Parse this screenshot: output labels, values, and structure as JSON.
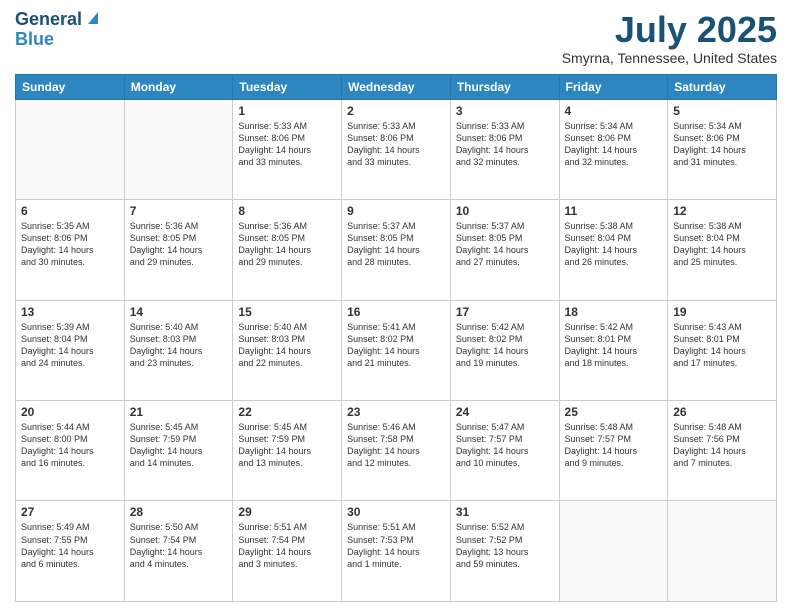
{
  "header": {
    "logo_line1": "General",
    "logo_line2": "Blue",
    "month": "July 2025",
    "location": "Smyrna, Tennessee, United States"
  },
  "weekdays": [
    "Sunday",
    "Monday",
    "Tuesday",
    "Wednesday",
    "Thursday",
    "Friday",
    "Saturday"
  ],
  "weeks": [
    [
      {
        "day": "",
        "lines": []
      },
      {
        "day": "",
        "lines": []
      },
      {
        "day": "1",
        "lines": [
          "Sunrise: 5:33 AM",
          "Sunset: 8:06 PM",
          "Daylight: 14 hours",
          "and 33 minutes."
        ]
      },
      {
        "day": "2",
        "lines": [
          "Sunrise: 5:33 AM",
          "Sunset: 8:06 PM",
          "Daylight: 14 hours",
          "and 33 minutes."
        ]
      },
      {
        "day": "3",
        "lines": [
          "Sunrise: 5:33 AM",
          "Sunset: 8:06 PM",
          "Daylight: 14 hours",
          "and 32 minutes."
        ]
      },
      {
        "day": "4",
        "lines": [
          "Sunrise: 5:34 AM",
          "Sunset: 8:06 PM",
          "Daylight: 14 hours",
          "and 32 minutes."
        ]
      },
      {
        "day": "5",
        "lines": [
          "Sunrise: 5:34 AM",
          "Sunset: 8:06 PM",
          "Daylight: 14 hours",
          "and 31 minutes."
        ]
      }
    ],
    [
      {
        "day": "6",
        "lines": [
          "Sunrise: 5:35 AM",
          "Sunset: 8:06 PM",
          "Daylight: 14 hours",
          "and 30 minutes."
        ]
      },
      {
        "day": "7",
        "lines": [
          "Sunrise: 5:36 AM",
          "Sunset: 8:05 PM",
          "Daylight: 14 hours",
          "and 29 minutes."
        ]
      },
      {
        "day": "8",
        "lines": [
          "Sunrise: 5:36 AM",
          "Sunset: 8:05 PM",
          "Daylight: 14 hours",
          "and 29 minutes."
        ]
      },
      {
        "day": "9",
        "lines": [
          "Sunrise: 5:37 AM",
          "Sunset: 8:05 PM",
          "Daylight: 14 hours",
          "and 28 minutes."
        ]
      },
      {
        "day": "10",
        "lines": [
          "Sunrise: 5:37 AM",
          "Sunset: 8:05 PM",
          "Daylight: 14 hours",
          "and 27 minutes."
        ]
      },
      {
        "day": "11",
        "lines": [
          "Sunrise: 5:38 AM",
          "Sunset: 8:04 PM",
          "Daylight: 14 hours",
          "and 26 minutes."
        ]
      },
      {
        "day": "12",
        "lines": [
          "Sunrise: 5:38 AM",
          "Sunset: 8:04 PM",
          "Daylight: 14 hours",
          "and 25 minutes."
        ]
      }
    ],
    [
      {
        "day": "13",
        "lines": [
          "Sunrise: 5:39 AM",
          "Sunset: 8:04 PM",
          "Daylight: 14 hours",
          "and 24 minutes."
        ]
      },
      {
        "day": "14",
        "lines": [
          "Sunrise: 5:40 AM",
          "Sunset: 8:03 PM",
          "Daylight: 14 hours",
          "and 23 minutes."
        ]
      },
      {
        "day": "15",
        "lines": [
          "Sunrise: 5:40 AM",
          "Sunset: 8:03 PM",
          "Daylight: 14 hours",
          "and 22 minutes."
        ]
      },
      {
        "day": "16",
        "lines": [
          "Sunrise: 5:41 AM",
          "Sunset: 8:02 PM",
          "Daylight: 14 hours",
          "and 21 minutes."
        ]
      },
      {
        "day": "17",
        "lines": [
          "Sunrise: 5:42 AM",
          "Sunset: 8:02 PM",
          "Daylight: 14 hours",
          "and 19 minutes."
        ]
      },
      {
        "day": "18",
        "lines": [
          "Sunrise: 5:42 AM",
          "Sunset: 8:01 PM",
          "Daylight: 14 hours",
          "and 18 minutes."
        ]
      },
      {
        "day": "19",
        "lines": [
          "Sunrise: 5:43 AM",
          "Sunset: 8:01 PM",
          "Daylight: 14 hours",
          "and 17 minutes."
        ]
      }
    ],
    [
      {
        "day": "20",
        "lines": [
          "Sunrise: 5:44 AM",
          "Sunset: 8:00 PM",
          "Daylight: 14 hours",
          "and 16 minutes."
        ]
      },
      {
        "day": "21",
        "lines": [
          "Sunrise: 5:45 AM",
          "Sunset: 7:59 PM",
          "Daylight: 14 hours",
          "and 14 minutes."
        ]
      },
      {
        "day": "22",
        "lines": [
          "Sunrise: 5:45 AM",
          "Sunset: 7:59 PM",
          "Daylight: 14 hours",
          "and 13 minutes."
        ]
      },
      {
        "day": "23",
        "lines": [
          "Sunrise: 5:46 AM",
          "Sunset: 7:58 PM",
          "Daylight: 14 hours",
          "and 12 minutes."
        ]
      },
      {
        "day": "24",
        "lines": [
          "Sunrise: 5:47 AM",
          "Sunset: 7:57 PM",
          "Daylight: 14 hours",
          "and 10 minutes."
        ]
      },
      {
        "day": "25",
        "lines": [
          "Sunrise: 5:48 AM",
          "Sunset: 7:57 PM",
          "Daylight: 14 hours",
          "and 9 minutes."
        ]
      },
      {
        "day": "26",
        "lines": [
          "Sunrise: 5:48 AM",
          "Sunset: 7:56 PM",
          "Daylight: 14 hours",
          "and 7 minutes."
        ]
      }
    ],
    [
      {
        "day": "27",
        "lines": [
          "Sunrise: 5:49 AM",
          "Sunset: 7:55 PM",
          "Daylight: 14 hours",
          "and 6 minutes."
        ]
      },
      {
        "day": "28",
        "lines": [
          "Sunrise: 5:50 AM",
          "Sunset: 7:54 PM",
          "Daylight: 14 hours",
          "and 4 minutes."
        ]
      },
      {
        "day": "29",
        "lines": [
          "Sunrise: 5:51 AM",
          "Sunset: 7:54 PM",
          "Daylight: 14 hours",
          "and 3 minutes."
        ]
      },
      {
        "day": "30",
        "lines": [
          "Sunrise: 5:51 AM",
          "Sunset: 7:53 PM",
          "Daylight: 14 hours",
          "and 1 minute."
        ]
      },
      {
        "day": "31",
        "lines": [
          "Sunrise: 5:52 AM",
          "Sunset: 7:52 PM",
          "Daylight: 13 hours",
          "and 59 minutes."
        ]
      },
      {
        "day": "",
        "lines": []
      },
      {
        "day": "",
        "lines": []
      }
    ]
  ]
}
